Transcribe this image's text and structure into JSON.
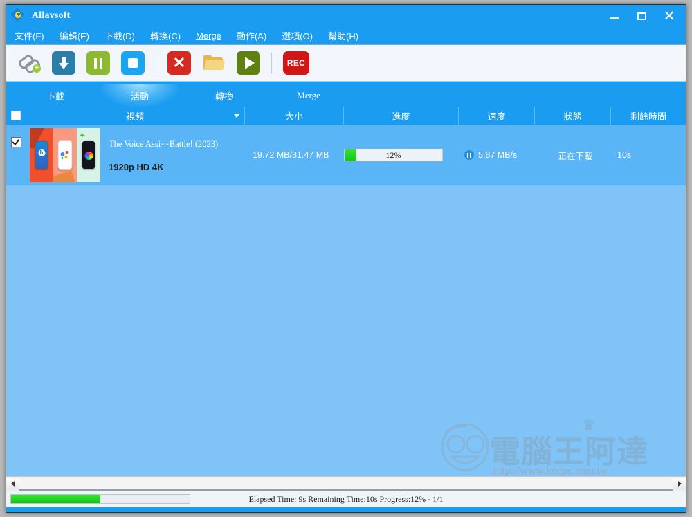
{
  "window": {
    "title": "Allavsoft",
    "controls": {
      "minimize": "minimize-icon",
      "maximize": "maximize-icon",
      "close": "✕"
    }
  },
  "menu": {
    "items": [
      {
        "label": "文件(F)",
        "name": "menu-file"
      },
      {
        "label": "編輯(E)",
        "name": "menu-edit"
      },
      {
        "label": "下載(D)",
        "name": "menu-download"
      },
      {
        "label": "轉換(C)",
        "name": "menu-convert"
      },
      {
        "label": "Merge",
        "name": "menu-merge"
      },
      {
        "label": "動作(A)",
        "name": "menu-action"
      },
      {
        "label": "選項(O)",
        "name": "menu-options"
      },
      {
        "label": "幫助(H)",
        "name": "menu-help"
      }
    ]
  },
  "toolbar": {
    "buttons": [
      {
        "name": "add-url-button",
        "icon": "link-plus-icon"
      },
      {
        "name": "download-button",
        "icon": "download-arrow-icon"
      },
      {
        "name": "pause-button",
        "icon": "pause-icon"
      },
      {
        "name": "stop-button",
        "icon": "stop-icon"
      },
      {
        "name": "delete-button",
        "icon": "close-x-icon"
      },
      {
        "name": "open-folder-button",
        "icon": "folder-icon"
      },
      {
        "name": "play-button",
        "icon": "play-icon"
      },
      {
        "name": "record-button",
        "icon": "rec-icon",
        "label": "REC"
      }
    ]
  },
  "tabs": [
    {
      "label": "下載",
      "name": "tab-download",
      "active": false
    },
    {
      "label": "活動",
      "name": "tab-activity",
      "active": true
    },
    {
      "label": "轉換",
      "name": "tab-convert",
      "active": false
    },
    {
      "label": "Merge",
      "name": "tab-merge",
      "active": false
    }
  ],
  "table": {
    "headers": {
      "video": "視頻",
      "size": "大小",
      "progress": "進度",
      "speed": "速度",
      "state": "狀態",
      "remaining": "剩餘時間"
    },
    "rows": [
      {
        "checked": true,
        "title": "The Voice Assi⋯Battle! (2023)",
        "quality": "1920p HD 4K",
        "size": "19.72 MB/81.47 MB",
        "progress_percent": 12,
        "progress_label": "12%",
        "speed": "5.87 MB/s",
        "state": "正在下載",
        "remaining": "10s"
      }
    ]
  },
  "statusbar": {
    "progress_percent": 12,
    "text": "Elapsed Time: 9s Remaining Time:10s Progress:12% - 1/1"
  },
  "watermark": {
    "text": "電腦王阿達",
    "url": "http://www.kocpc.com.tw"
  },
  "colors": {
    "brand_blue": "#1a9cf0",
    "row_blue": "#59b5f6",
    "list_bg": "#7fc3f7",
    "progress_green": "#13c913"
  }
}
